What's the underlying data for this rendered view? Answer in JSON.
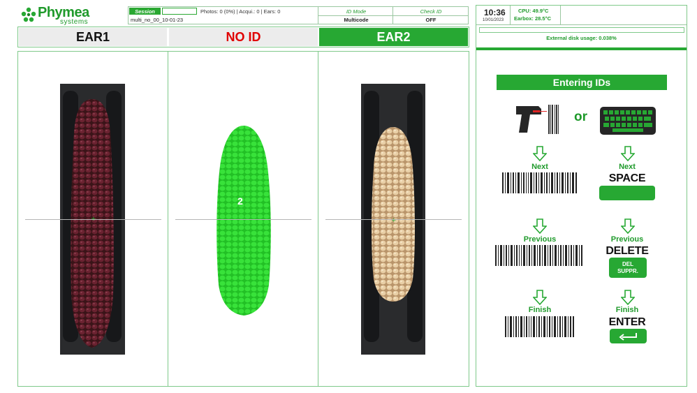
{
  "brand": {
    "name": "Phymea",
    "sub": "systems"
  },
  "session": {
    "tag": "Session",
    "stats": "Photos: 0 (0%) | Acqui.: 0 | Ears: 0",
    "name": "multi_no_00_10-01-23"
  },
  "id_mode": {
    "label": "ID Mode",
    "value": "Multicode"
  },
  "check_id": {
    "label": "Check ID",
    "value": "OFF"
  },
  "tabs": [
    {
      "label": "EAR1"
    },
    {
      "label": "NO ID"
    },
    {
      "label": "EAR2"
    }
  ],
  "panels": {
    "segment_number": "2"
  },
  "status": {
    "time": "10:36",
    "date": "10/01/2023",
    "cpu": "CPU: 49.9°C",
    "earbox": "Earbox: 28.5°C",
    "disk": "External disk usage: 0.038%",
    "disk_usage_percent": 0.038
  },
  "instructions": {
    "title": "Entering IDs",
    "or": "or",
    "next_label": "Next",
    "previous_label": "Previous",
    "finish_label": "Finish",
    "space_key": "SPACE",
    "delete_key": "DELETE",
    "del_key_line1": "DEL",
    "del_key_line2": "SUPPR.",
    "enter_key": "ENTER"
  },
  "colors": {
    "accent": "#27a833",
    "no_id": "#e00000",
    "tab_inactive": "#ececec"
  }
}
